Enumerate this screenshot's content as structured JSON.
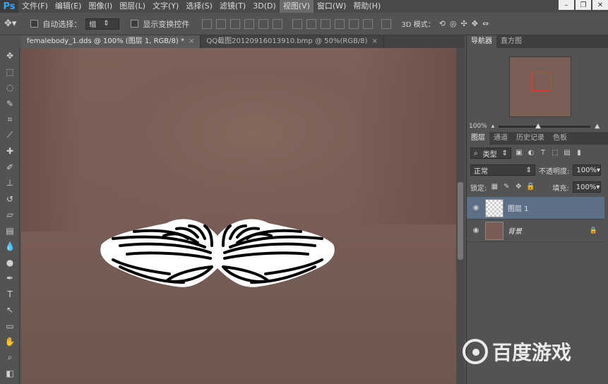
{
  "menubar": {
    "logo": "Ps",
    "items": [
      "文件(F)",
      "编辑(E)",
      "图像(I)",
      "图层(L)",
      "文字(Y)",
      "选择(S)",
      "滤镜(T)",
      "3D(D)",
      "视图(V)",
      "窗口(W)",
      "帮助(H)"
    ],
    "active_index": 8
  },
  "options": {
    "auto_select_label": "自动选择：",
    "auto_select_value": "组",
    "show_transform_label": "显示变换控件",
    "mode_3d_label": "3D 模式："
  },
  "tabs": [
    {
      "label": "femalebody_1.dds @ 100% (图层 1, RGB/8) *",
      "active": true
    },
    {
      "label": "QQ截图20120916013910.bmp @ 50%(RGB/8)",
      "active": false
    }
  ],
  "navigator": {
    "tabs": [
      "导航器",
      "直方图"
    ],
    "zoom": "100%"
  },
  "layers_panel": {
    "tabs": [
      "图层",
      "通道",
      "历史记录",
      "色板"
    ],
    "filter_label": "类型",
    "blend_mode": "正常",
    "opacity_label": "不透明度:",
    "opacity_value": "100%",
    "lock_label": "锁定:",
    "fill_label": "填充:",
    "fill_value": "100%",
    "layers": [
      {
        "name": "图层 1",
        "selected": true
      },
      {
        "name": "背景",
        "selected": false,
        "locked": true
      }
    ]
  },
  "watermark": "百度游戏",
  "colors": {
    "selected_layer": "#5c6f87",
    "skin": "#7b6057",
    "accent_red": "#e33"
  }
}
